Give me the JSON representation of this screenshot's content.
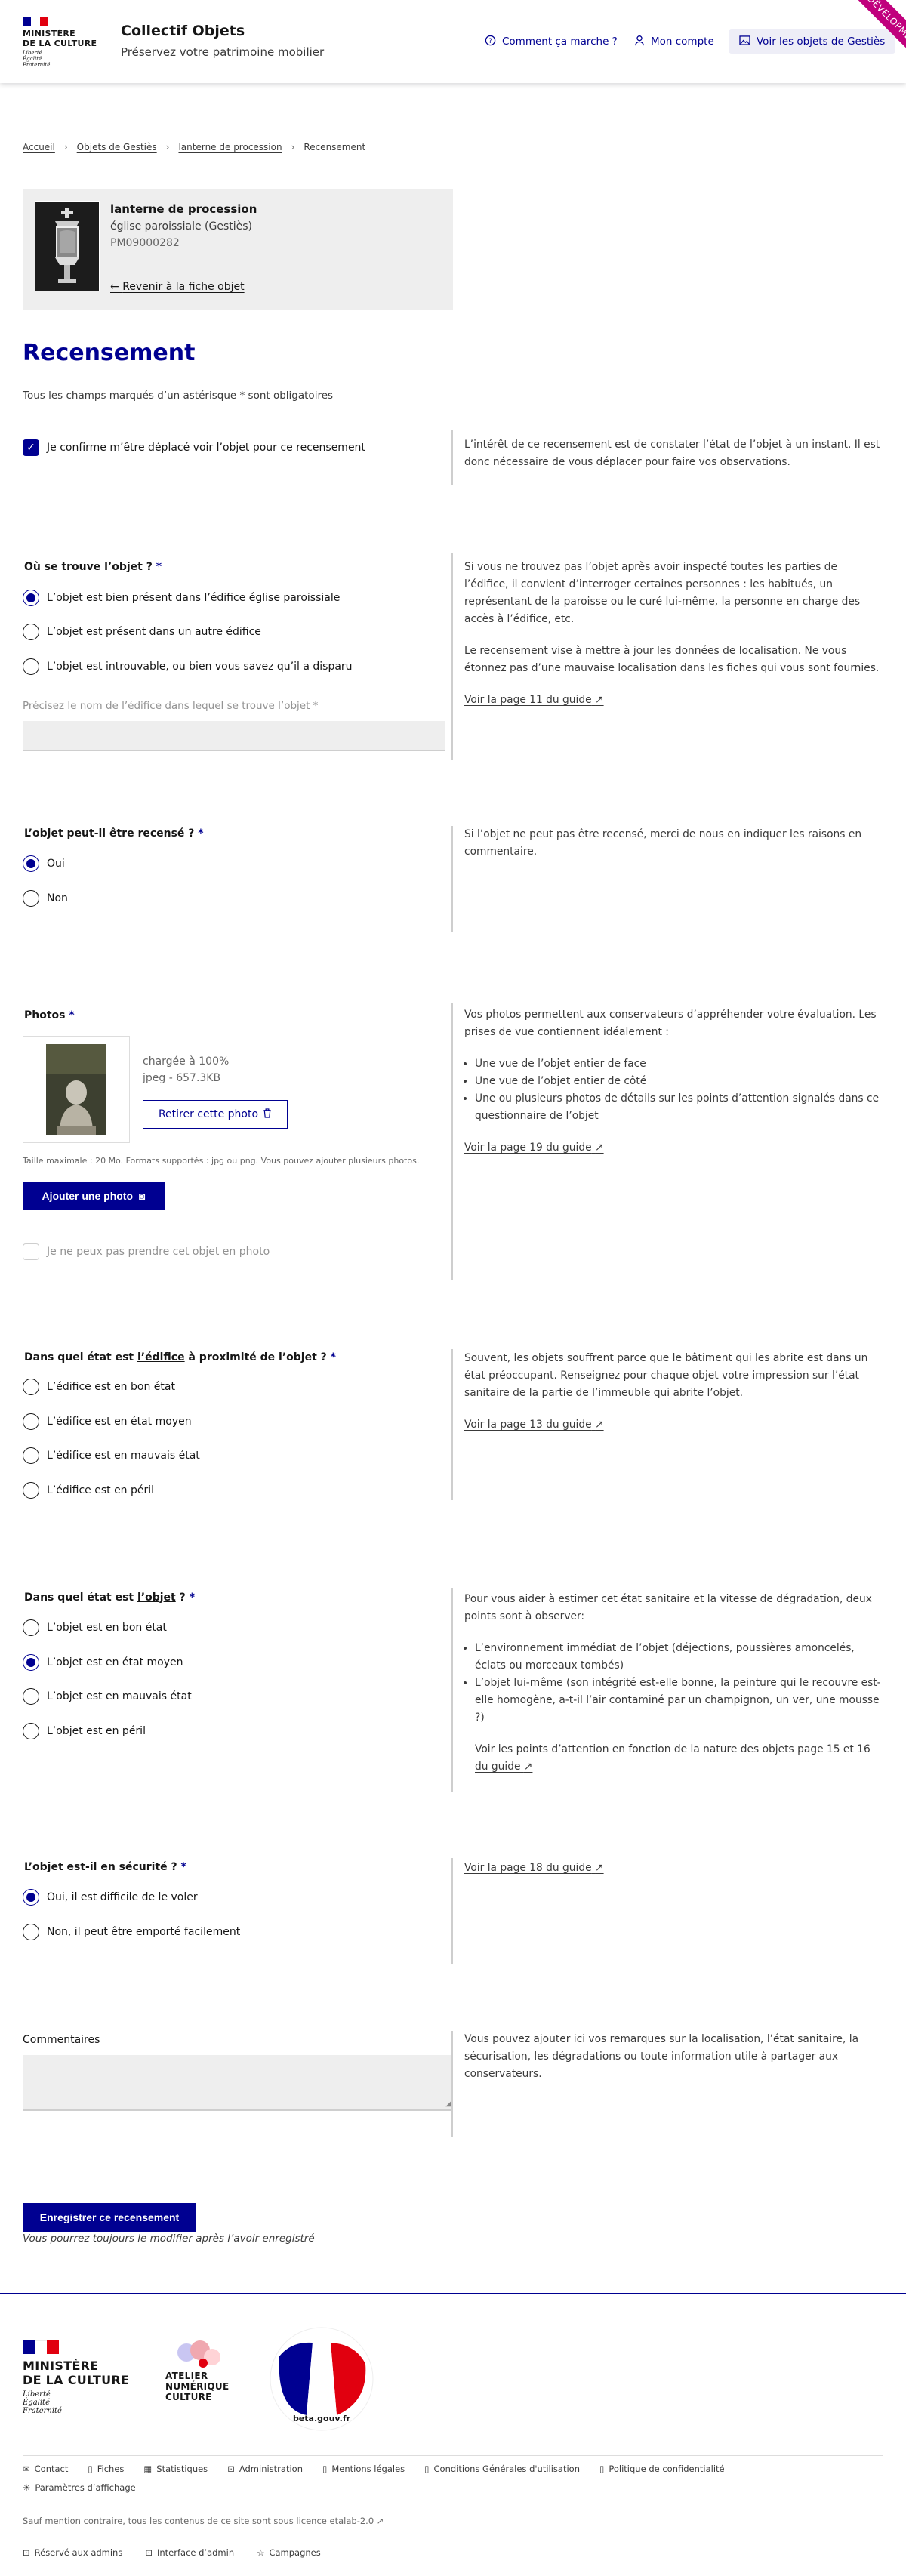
{
  "header": {
    "ministry": [
      "MINISTÈRE",
      "DE LA CULTURE"
    ],
    "devise": [
      "Liberté",
      "Égalité",
      "Fraternité"
    ],
    "site_title": "Collectif Objets",
    "site_tagline": "Préservez votre patrimoine mobilier",
    "links": [
      "Comment ça marche ?",
      "Mon compte",
      "Voir les objets de Gestiès"
    ],
    "ribbon": "DÉVELOPMENT"
  },
  "breadcrumb": [
    "Accueil",
    "Objets de Gestiès",
    "lanterne de procession",
    "Recensement"
  ],
  "object": {
    "name": "lanterne de procession",
    "location": "église paroissiale (Gestiès)",
    "ref": "PM09000282",
    "back_link": "Revenir à la fiche objet"
  },
  "page_title": "Recensement",
  "mandatory_note": "Tous les champs marqués d’un astérisque * sont obligatoires",
  "confirm": {
    "label": "Je confirme m’être déplacé voir l’objet pour ce recensement",
    "help": "L’intérêt de ce recensement est de constater l’état de l’objet à un instant. Il est donc nécessaire de vous déplacer pour faire vos observations."
  },
  "location_q": {
    "label": "Où se trouve l’objet ?",
    "options": [
      "L’objet est bien présent dans l’édifice église paroissiale",
      "L’objet est présent dans un autre édifice",
      "L’objet est introuvable, ou bien vous savez qu’il a disparu"
    ],
    "input_label": "Précisez le nom de l’édifice dans lequel se trouve l’objet *",
    "help": [
      "Si vous ne trouvez pas l’objet après avoir inspecté toutes les parties de l’édifice, il convient d’interroger certaines personnes : les habitués, un représentant de la paroisse ou le curé lui-même, la personne en charge des accès à l’édifice, etc.",
      "Le recensement vise à mettre à jour les données de localisation. Ne vous étonnez pas d’une mauvaise localisation dans les fiches qui vous sont fournies."
    ],
    "guide": "Voir la page 11 du guide"
  },
  "recensable_q": {
    "label": "L’objet peut-il être recensé ?",
    "options": [
      "Oui",
      "Non"
    ],
    "help": "Si l’objet ne peut pas être recensé, merci de nous en indiquer les raisons en commentaire."
  },
  "photos": {
    "label": "Photos",
    "status": "chargée à 100%",
    "meta": "jpeg - 657.3KB",
    "remove": "Retirer cette photo",
    "hint": "Taille maximale : 20 Mo. Formats supportés : jpg ou png. Vous pouvez ajouter plusieurs photos.",
    "add": "Ajouter une photo",
    "no_photo": "Je ne peux pas prendre cet objet en photo",
    "help_intro": "Vos photos permettent aux conservateurs d’appréhender votre évaluation. Les prises de vue contiennent idéalement :",
    "help_items": [
      "Une vue de l’objet entier de face",
      "Une vue de l’objet entier de côté",
      "Une ou plusieurs photos de détails sur les points d’attention signalés dans ce questionnaire de l’objet"
    ],
    "guide": "Voir la page 19 du guide"
  },
  "edifice_q": {
    "label_pre": "Dans quel état est ",
    "label_link": "l’édifice",
    "label_post": " à proximité de l’objet ?",
    "options": [
      "L’édifice est en bon état",
      "L’édifice est en état moyen",
      "L’édifice est en mauvais état",
      "L’édifice est en péril"
    ],
    "help": "Souvent, les objets souffrent parce que le bâtiment qui les abrite est dans un état préoccupant. Renseignez pour chaque objet votre impression sur l’état sanitaire de la partie de l’immeuble qui abrite l’objet.",
    "guide": "Voir la page 13 du guide"
  },
  "objet_q": {
    "label_pre": "Dans quel état est ",
    "label_link": "l’objet",
    "label_post": " ?",
    "options": [
      "L’objet est en bon état",
      "L’objet est en état moyen",
      "L’objet est en mauvais état",
      "L’objet est en péril"
    ],
    "help_intro": "Pour vous aider à estimer cet état sanitaire et la vitesse de dégradation, deux points sont à observer:",
    "help_items": [
      "L’environnement immédiat de l’objet (déjections, poussières amoncelés, éclats ou morceaux tombés)",
      "L’objet lui-même (son intégrité est-elle bonne, la peinture qui le recouvre est-elle homogène, a-t-il l’air contaminé par un champignon, un ver, une mousse ?)"
    ],
    "guide": "Voir les points d’attention en fonction de la nature des objets page 15 et 16 du guide"
  },
  "securite_q": {
    "label": "L’objet est-il en sécurité ?",
    "options": [
      "Oui, il est difficile de le voler",
      "Non, il peut être emporté facilement"
    ],
    "guide": "Voir la page 18 du guide"
  },
  "comments": {
    "label": "Commentaires",
    "help": "Vous pouvez ajouter ici vos remarques sur la localisation, l’état sanitaire, la sécurisation, les dégradations ou toute information utile à partager aux conservateurs."
  },
  "submit": {
    "label": "Enregistrer ce recensement",
    "note": "Vous pourrez toujours le modifier après l’avoir enregistré"
  },
  "footer": {
    "ministry": [
      "MINISTÈRE",
      "DE LA CULTURE"
    ],
    "devise": [
      "Liberté",
      "Égalité",
      "Fraternité"
    ],
    "atelier": [
      "ATELIER",
      "NUMÉRIQUE",
      "CULTURE"
    ],
    "beta": "beta.gouv.fr",
    "links": [
      "Contact",
      "Fiches",
      "Statistiques",
      "Administration",
      "Mentions légales",
      "Conditions Générales d'utilisation",
      "Politique de confidentialité"
    ],
    "display_settings": "Paramètres d’affichage",
    "license_pre": "Sauf mention contraire, tous les contenus de ce site sont sous ",
    "license_link": "licence etalab-2.0",
    "admin_notice": "Réservé aux admins",
    "admin_links": [
      "Interface d’admin",
      "Campagnes"
    ]
  }
}
